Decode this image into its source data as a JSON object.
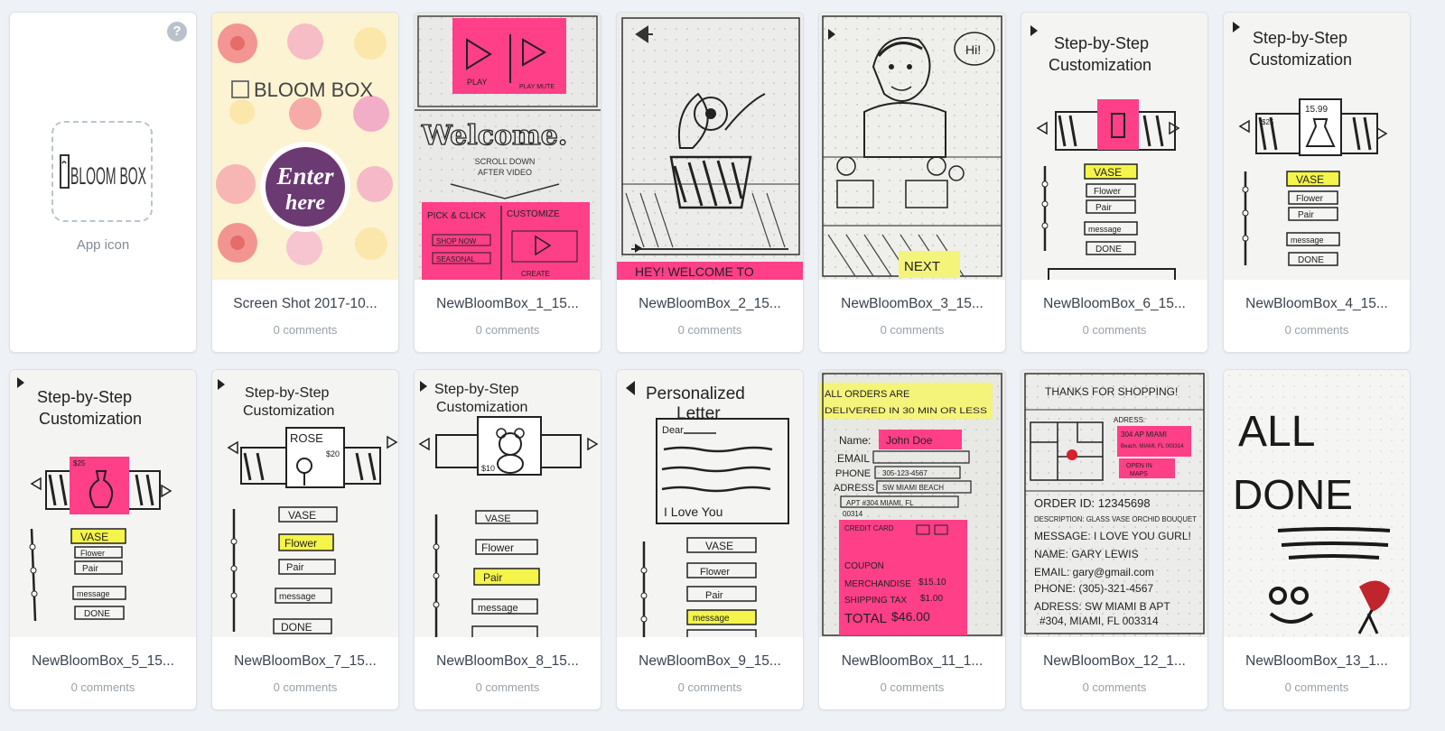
{
  "app_icon": {
    "label": "App icon",
    "help_glyph": "?",
    "logo_text": "BLOOM BOX"
  },
  "colors": {
    "sticky_pink": "#ff3f87",
    "sticky_yellow": "#f4f44a",
    "splash_bg": "#fbf3d2",
    "enter_purple": "#6b3a73",
    "paper": "#f2f2ef"
  },
  "screens": [
    {
      "title": "Screen Shot 2017-10...",
      "comments": "0 comments",
      "sketch": "splash"
    },
    {
      "title": "NewBloomBox_1_15...",
      "comments": "0 comments",
      "sketch": "welcome"
    },
    {
      "title": "NewBloomBox_2_15...",
      "comments": "0 comments",
      "sketch": "vase-video"
    },
    {
      "title": "NewBloomBox_3_15...",
      "comments": "0 comments",
      "sketch": "florist"
    },
    {
      "title": "NewBloomBox_6_15...",
      "comments": "0 comments",
      "sketch": "step-vase"
    },
    {
      "title": "NewBloomBox_4_15...",
      "comments": "0 comments",
      "sketch": "step-vase-price"
    },
    {
      "title": "NewBloomBox_5_15...",
      "comments": "0 comments",
      "sketch": "step-vase-pink"
    },
    {
      "title": "NewBloomBox_7_15...",
      "comments": "0 comments",
      "sketch": "step-flower"
    },
    {
      "title": "NewBloomBox_8_15...",
      "comments": "0 comments",
      "sketch": "step-pair"
    },
    {
      "title": "NewBloomBox_9_15...",
      "comments": "0 comments",
      "sketch": "letter"
    },
    {
      "title": "NewBloomBox_11_1...",
      "comments": "0 comments",
      "sketch": "order-form"
    },
    {
      "title": "NewBloomBox_12_1...",
      "comments": "0 comments",
      "sketch": "thanks"
    },
    {
      "title": "NewBloomBox_13_1...",
      "comments": "0 comments",
      "sketch": "all-done"
    }
  ],
  "sketch_text": {
    "splash": {
      "logo": "BLOOM BOX",
      "enter_1": "Enter",
      "enter_2": "here"
    },
    "welcome": {
      "play": "PLAY",
      "play_mute": "PLAY MUTE",
      "heading": "Welcome.",
      "scroll_1": "SCROLL DOWN",
      "scroll_2": "AFTER VIDEO",
      "pick": "PICK & CLICK",
      "customize": "CUSTOMIZE",
      "shop": "SHOP NOW",
      "seasonal": "SEASONAL",
      "create": "CREATE"
    },
    "vase_video": {
      "banner": "HEY! WELCOME TO"
    },
    "florist": {
      "hi": "Hi!",
      "next": "NEXT"
    },
    "step": {
      "line_1": "Step-by-Step",
      "line_2": "Customization",
      "vase": "VASE",
      "flower": "Flower",
      "pair": "Pair",
      "message": "message",
      "done": "DONE"
    },
    "step_vase_price": {
      "price_left": "$25",
      "price_mid": "15.99"
    },
    "step_vase_pink": {
      "price": "$25"
    },
    "step_flower": {
      "rose": "ROSE",
      "price": "$20"
    },
    "step_pair": {
      "price": "$10"
    },
    "letter": {
      "title_1": "Personalized",
      "title_2": "Letter",
      "dear": "Dear",
      "love": "I Love You"
    },
    "order": {
      "banner_1": "ALL ORDERS ARE",
      "banner_2": "DELIVERED IN 30 MIN OR LESS",
      "name_label": "Name:",
      "name": "John Doe",
      "email": "EMAIL",
      "phone": "PHONE",
      "phone_val": "305-123-4567",
      "address": "ADRESS",
      "address_val": "SW MIAMI BEACH",
      "apt": "APT #304 MIAMI, FL",
      "zip": "00314",
      "credit": "CREDIT CARD",
      "coupon": "COUPON",
      "merch": "MERCHANDISE",
      "merch_val": "$15.10",
      "shipping": "SHIPPING TAX",
      "shipping_val": "$1.00",
      "total": "TOTAL",
      "total_val": "$46.00"
    },
    "thanks": {
      "heading": "THANKS FOR SHOPPING!",
      "adress": "ADRESS:",
      "sticky_1": "304 AP MIAMI",
      "sticky_2": "Beach, MIAMI, FL 003314",
      "open_1": "OPEN IN",
      "open_2": "MAPS",
      "order_id": "ORDER ID: 12345698",
      "desc": "DESCRIPTION: GLASS VASE ORCHID BOUQUET",
      "message": "MESSAGE: I LOVE YOU GURL!",
      "name": "NAME: GARY LEWIS",
      "email": "EMAIL: gary@gmail.com",
      "phone": "PHONE: (305)-321-4567",
      "adress_2": "ADRESS: SW MIAMI B APT",
      "adress_3": "#304, MIAMI, FL 003314"
    },
    "all_done": {
      "line_1": "ALL",
      "line_2": "DONE"
    }
  }
}
